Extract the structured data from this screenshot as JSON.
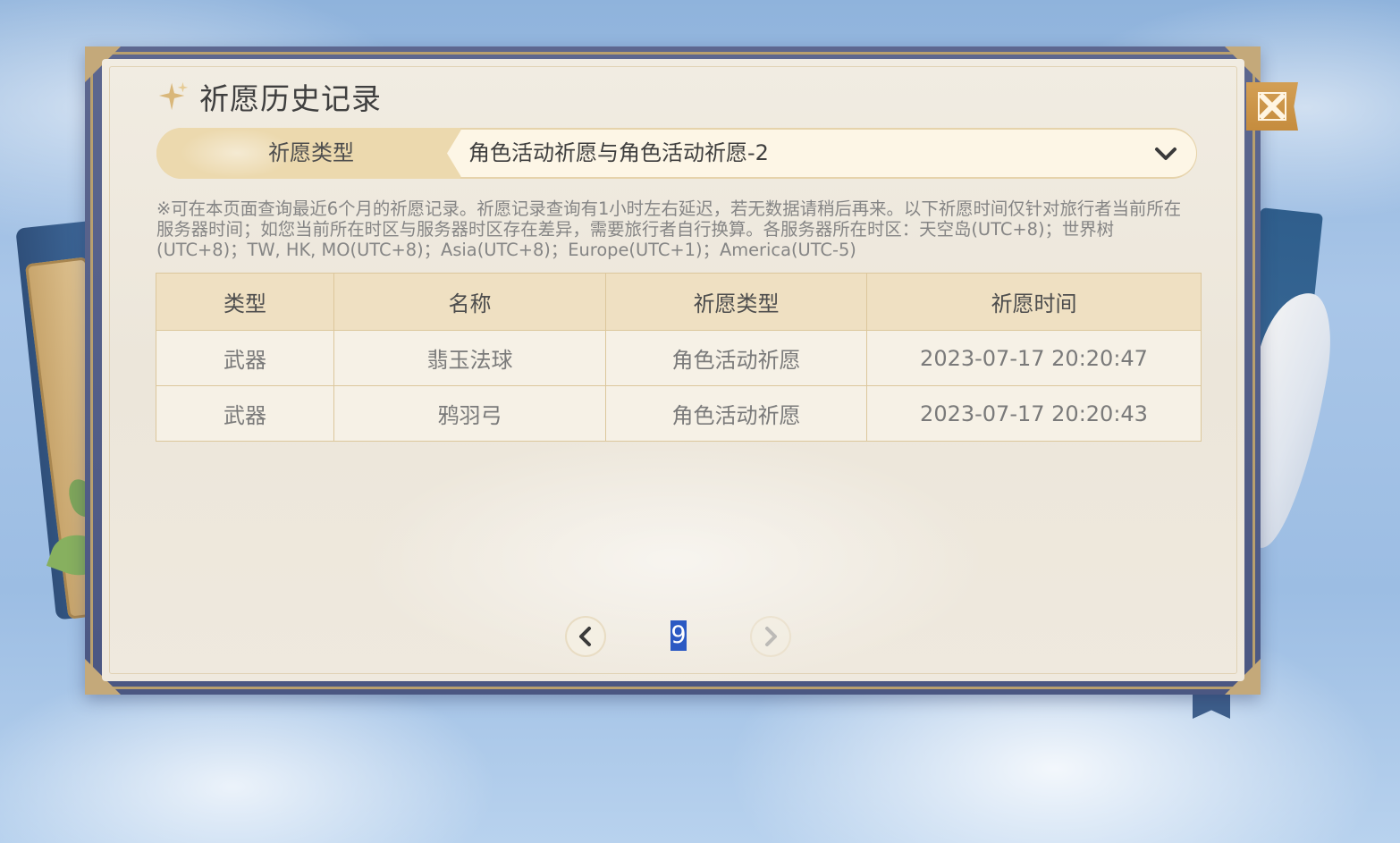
{
  "window": {
    "title": "祈愿历史记录"
  },
  "filter": {
    "label": "祈愿类型",
    "selected": "角色活动祈愿与角色活动祈愿-2"
  },
  "notice": "※可在本页面查询最近6个月的祈愿记录。祈愿记录查询有1小时左右延迟，若无数据请稍后再来。以下祈愿时间仅针对旅行者当前所在服务器时间；如您当前所在时区与服务器时区存在差异，需要旅行者自行换算。各服务器所在时区：天空岛(UTC+8)；世界树(UTC+8)；TW, HK, MO(UTC+8)；Asia(UTC+8)；Europe(UTC+1)；America(UTC-5)",
  "table": {
    "headers": [
      "类型",
      "名称",
      "祈愿类型",
      "祈愿时间"
    ],
    "rows": [
      [
        "武器",
        "翡玉法球",
        "角色活动祈愿",
        "2023-07-17 20:20:47"
      ],
      [
        "武器",
        "鸦羽弓",
        "角色活动祈愿",
        "2023-07-17 20:20:43"
      ]
    ]
  },
  "pagination": {
    "current_page": "9"
  },
  "icons": {
    "title": "sparkle-icon",
    "close": "close-icon",
    "dropdown": "chevron-down-icon",
    "prev": "chevron-left-icon",
    "next": "chevron-right-icon"
  },
  "colors": {
    "paper": "#efe9de",
    "frame": "#5d678f",
    "accent_gold": "#c58c3e",
    "table_header": "#efe0c2",
    "table_border": "#dcc79c",
    "page_highlight": "#2b59c3"
  }
}
